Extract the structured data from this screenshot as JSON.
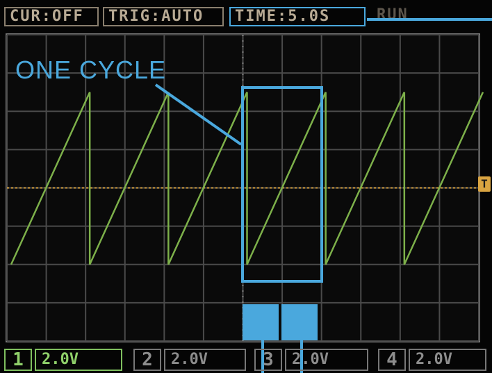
{
  "status": {
    "cursor": "CUR:OFF",
    "trigger": "TRIG:AUTO",
    "time": "TIME:5.0S",
    "run": "RUN"
  },
  "annotation": {
    "label": "ONE CYCLE",
    "color": "#4aa8dd"
  },
  "trigger_marker": "T",
  "waveform": {
    "shape": "sawtooth",
    "color": "#7db04a",
    "cycles_visible": 6
  },
  "channels": [
    {
      "number": "1",
      "scale": "2.0V",
      "active": true
    },
    {
      "number": "2",
      "scale": "2.0V",
      "active": false
    },
    {
      "number": "3",
      "scale": "2.0V",
      "active": false
    },
    {
      "number": "4",
      "scale": "2.0V",
      "active": false
    }
  ],
  "colors": {
    "grid": "#4a4a4a",
    "trace": "#7db04a",
    "trigger_level": "#d9a441",
    "annotation": "#4aa8dd"
  }
}
